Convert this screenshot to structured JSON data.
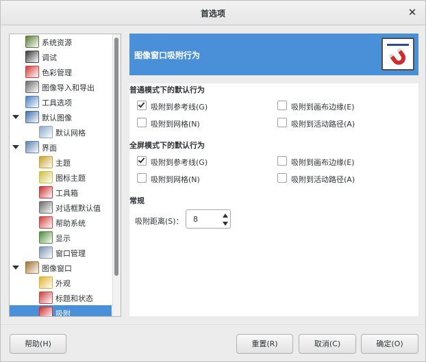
{
  "dialog": {
    "title": "首选项",
    "close_glyph": "✕"
  },
  "sidebar": {
    "items": [
      {
        "label": "系统资源",
        "icon": "system-resources-icon",
        "color": "#5a7a3a"
      },
      {
        "label": "调试",
        "icon": "debug-icon",
        "color": "#3a3a3a"
      },
      {
        "label": "色彩管理",
        "icon": "color-management-icon",
        "color": "#d23c3c"
      },
      {
        "label": "图像导入和导出",
        "icon": "image-import-export-icon",
        "color": "#6b6b6b"
      },
      {
        "label": "工具选项",
        "icon": "tool-options-icon",
        "color": "#4a7fc0"
      },
      {
        "label": "默认图像",
        "icon": "default-image-icon",
        "color": "#3f6ea6",
        "expanded": true
      },
      {
        "label": "默认网格",
        "icon": "default-grid-icon",
        "color": "#8aa6c8"
      },
      {
        "label": "界面",
        "icon": "interface-icon",
        "color": "#5b7fae",
        "expanded": true
      },
      {
        "label": "主题",
        "icon": "theme-icon",
        "color": "#c8a030"
      },
      {
        "label": "图标主题",
        "icon": "icon-theme-icon",
        "color": "#d0c040"
      },
      {
        "label": "工具箱",
        "icon": "toolbox-icon",
        "color": "#c83232"
      },
      {
        "label": "对话框默认值",
        "icon": "dialog-defaults-icon",
        "color": "#6a6a6a"
      },
      {
        "label": "帮助系统",
        "icon": "help-system-icon",
        "color": "#d04040"
      },
      {
        "label": "显示",
        "icon": "display-icon",
        "color": "#4f8a3c"
      },
      {
        "label": "窗口管理",
        "icon": "window-management-icon",
        "color": "#7a90b0"
      },
      {
        "label": "图像窗口",
        "icon": "image-window-icon",
        "color": "#a07030",
        "expanded": true
      },
      {
        "label": "外观",
        "icon": "appearance-icon",
        "color": "#e0b030"
      },
      {
        "label": "标题和状态",
        "icon": "title-status-icon",
        "color": "#c84040"
      },
      {
        "label": "吸附",
        "icon": "snapping-icon",
        "color": "#d03030",
        "selected": true
      }
    ]
  },
  "panel": {
    "title": "图像窗口吸附行为",
    "icon": "magnet-icon",
    "accent": "#4a90d9",
    "normal_section": {
      "title": "普通模式下的默认行为",
      "options": [
        {
          "label": "吸附到参考线(G)",
          "checked": true
        },
        {
          "label": "吸附到画布边缘(E)",
          "checked": false
        },
        {
          "label": "吸附到网格(N)",
          "checked": false
        },
        {
          "label": "吸附到活动路径(A)",
          "checked": false
        }
      ]
    },
    "fullscreen_section": {
      "title": "全屏模式下的默认行为",
      "options": [
        {
          "label": "吸附到参考线(G)",
          "checked": true
        },
        {
          "label": "吸附到画布边缘(E)",
          "checked": false
        },
        {
          "label": "吸附到网格(N)",
          "checked": false
        },
        {
          "label": "吸附到活动路径(A)",
          "checked": false
        }
      ]
    },
    "general_section": {
      "title": "常规",
      "snap_distance_label": "吸附距离(S)：",
      "snap_distance_value": "8"
    }
  },
  "buttons": {
    "help": "帮助(H)",
    "reset": "重置(R)",
    "cancel": "取消(C)",
    "ok": "确定(O)"
  }
}
